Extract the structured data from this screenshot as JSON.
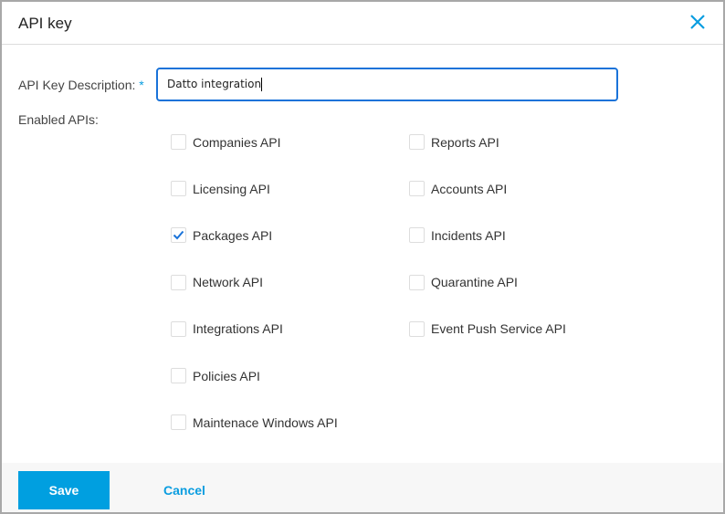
{
  "dialog": {
    "title": "API key",
    "close_icon": "close-icon"
  },
  "form": {
    "description_label": "API Key Description:",
    "required_mark": "*",
    "description_value": "Datto integration",
    "enabled_label": "Enabled APIs:"
  },
  "apis_left": [
    {
      "label": "Companies API",
      "checked": false
    },
    {
      "label": "Licensing API",
      "checked": false
    },
    {
      "label": "Packages API",
      "checked": true
    },
    {
      "label": "Network API",
      "checked": false
    },
    {
      "label": "Integrations API",
      "checked": false
    },
    {
      "label": "Policies API",
      "checked": false
    },
    {
      "label": "Maintenace Windows API",
      "checked": false
    }
  ],
  "apis_right": [
    {
      "label": "Reports API",
      "checked": false
    },
    {
      "label": "Accounts API",
      "checked": false
    },
    {
      "label": "Incidents API",
      "checked": false
    },
    {
      "label": "Quarantine API",
      "checked": false
    },
    {
      "label": "Event Push Service API",
      "checked": false
    }
  ],
  "footer": {
    "save": "Save",
    "cancel": "Cancel"
  },
  "colors": {
    "accent": "#009fe0",
    "focus": "#1a73d9"
  }
}
